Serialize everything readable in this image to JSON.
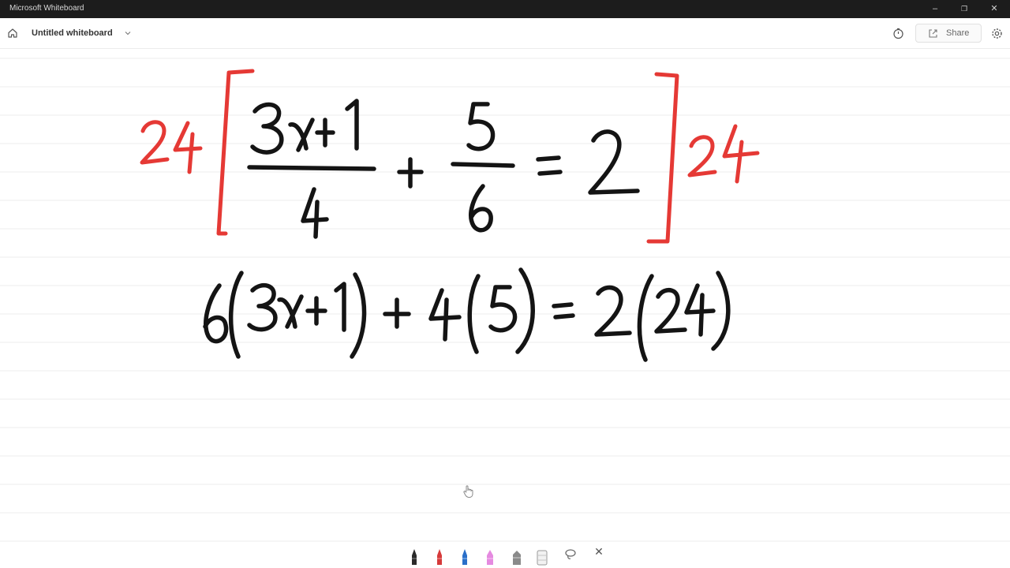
{
  "window": {
    "app_title": "Microsoft Whiteboard",
    "minimize_glyph": "–",
    "maximize_glyph": "❐",
    "close_glyph": "✕"
  },
  "commandbar": {
    "board_title": "Untitled whiteboard",
    "share_label": "Share",
    "icons": [
      "home-icon",
      "chevron-down-icon",
      "timer-icon",
      "share-icon",
      "settings-icon"
    ]
  },
  "whiteboard": {
    "equation_1": "24[ (3x+1)/4 + 5/6 = 2 ]24",
    "equation_2": "6(3x+1) + 4(5) = 2(24)",
    "colors": {
      "black_ink": "#141414",
      "red_ink": "#e53935",
      "rule_lines": "#ececec"
    }
  },
  "toolbar": {
    "tools": [
      "black-pen-icon",
      "red-pen-icon",
      "blue-pen-icon",
      "pink-highlighter-icon",
      "highlighter-icon",
      "eraser-icon",
      "lasso-icon",
      "close-icon"
    ],
    "close_glyph": "✕"
  }
}
